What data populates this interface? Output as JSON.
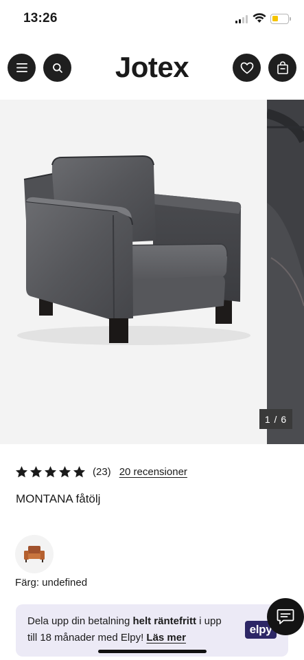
{
  "status_bar": {
    "time": "13:26",
    "signal_bars_active": 2,
    "signal_bars_total": 4,
    "battery_level": 0.3,
    "battery_color": "#f5c400"
  },
  "header": {
    "logo": "Jotex",
    "icons": [
      "menu-icon",
      "search-icon",
      "heart-icon",
      "shopping-bag-icon"
    ]
  },
  "gallery": {
    "counter": "1 / 6",
    "product_color": "#5a5b5e"
  },
  "rating": {
    "stars": 5,
    "max_stars": 5,
    "count": "(23)",
    "reviews_link": "20 recensioner"
  },
  "product": {
    "name": "MONTANA fåtölj",
    "color_label": "Färg: undefined"
  },
  "elpy_banner": {
    "text_before": "Dela upp din betalning ",
    "text_bold": "helt räntefritt",
    "text_after": " i upp till 18 månader med Elpy! ",
    "link": "Läs mer",
    "logo": "elpy",
    "background": "#eceaf6",
    "logo_color": "#2d2766"
  }
}
